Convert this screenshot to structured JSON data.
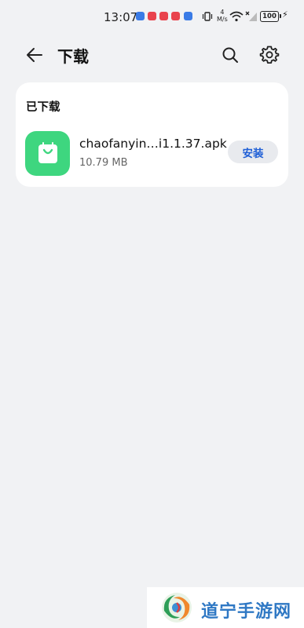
{
  "status_bar": {
    "time": "13:07",
    "network_speed_top": "4",
    "network_speed_unit": "M/s",
    "battery": "100",
    "notification_colors": [
      "#3a7be6",
      "#e9434d",
      "#e9434d",
      "#e9434d",
      "#3a7be6"
    ]
  },
  "header": {
    "title": "下载",
    "back_icon": "arrow-left",
    "search_icon": "search",
    "settings_icon": "gear"
  },
  "downloads": {
    "section_title": "已下载",
    "items": [
      {
        "file_name": "chaofanyin…i1.1.37.apk",
        "file_size": "10.79 MB",
        "action_label": "安装",
        "icon": "shopping-bag",
        "icon_color": "#3ed67f"
      }
    ]
  },
  "watermark": {
    "text": "道宁手游网"
  },
  "colors": {
    "background": "#f1f2f4",
    "card": "#ffffff",
    "accent": "#1f5fd6",
    "watermark_text": "#2f78c4"
  }
}
